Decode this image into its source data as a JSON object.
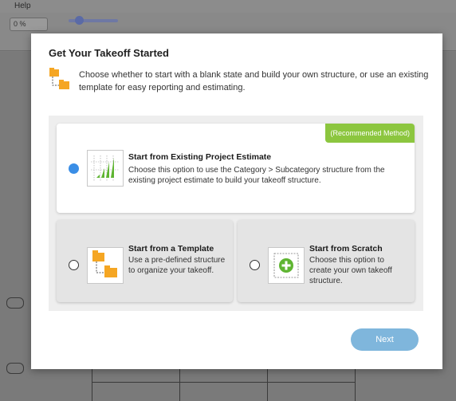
{
  "app": {
    "menu_help": "Help",
    "zoom_value": "0 %"
  },
  "modal": {
    "title": "Get Your Takeoff Started",
    "intro": "Choose whether to start with a blank state and build your own structure, or use an existing template for easy reporting and estimating.",
    "options": [
      {
        "title": "Start from Existing Project Estimate",
        "description": "Choose this option to use the Category > Subcategory structure from the existing project estimate to build your takeoff structure.",
        "badge": "(Recommended Method)",
        "selected": true,
        "icon": "bar-chart-icon"
      },
      {
        "title": "Start from a Template",
        "description": "Use a pre-defined structure to organize your takeoff.",
        "selected": false,
        "icon": "folder-tree-icon"
      },
      {
        "title": "Start from Scratch",
        "description": "Choose this option to create your own takeoff structure.",
        "selected": false,
        "icon": "add-circle-icon"
      }
    ],
    "next_label": "Next"
  },
  "colors": {
    "accent_blue": "#3a8ee6",
    "badge_green": "#8cc63f",
    "chart_green": "#5fb532",
    "folder_orange": "#f5a623",
    "next_button": "#7fb6dc"
  }
}
